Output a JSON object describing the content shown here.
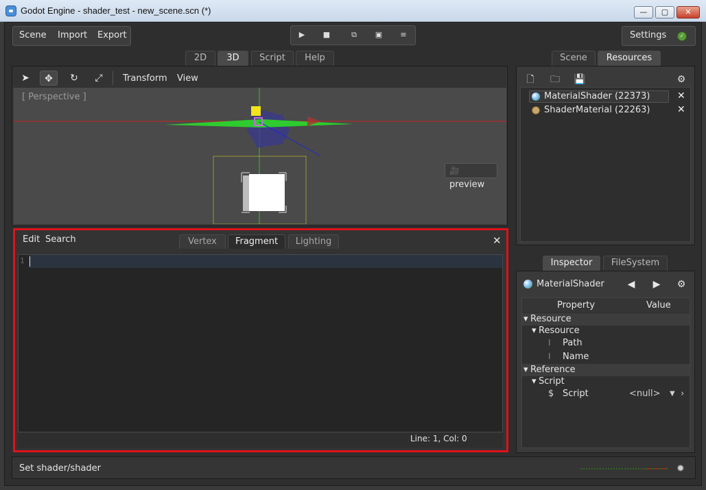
{
  "window": {
    "title": "Godot Engine - shader_test - new_scene.scn (*)",
    "controls": {
      "minimize": "—",
      "maximize": "▢",
      "close": "✕"
    }
  },
  "menu": {
    "scene": "Scene",
    "import": "Import",
    "export": "Export"
  },
  "playback": {
    "play": "▶",
    "stop": "■",
    "play_scene": "⧉",
    "play_custom": "▣",
    "more": "≡"
  },
  "settings": {
    "label": "Settings",
    "ok_icon": "✓"
  },
  "main_tabs": [
    {
      "label": "2D"
    },
    {
      "label": "3D"
    },
    {
      "label": "Script"
    },
    {
      "label": "Help"
    }
  ],
  "viewport": {
    "tools": {
      "select": "➤",
      "move": "✥",
      "rotate": "↻",
      "scale": "⤢"
    },
    "menus": {
      "transform": "Transform",
      "view": "View"
    },
    "perspective_label": "[ Perspective ]",
    "preview_label": "preview",
    "preview_icon": "🎥"
  },
  "shader_editor": {
    "menus": {
      "edit": "Edit",
      "search": "Search"
    },
    "tabs": [
      {
        "label": "Vertex"
      },
      {
        "label": "Fragment"
      },
      {
        "label": "Lighting"
      }
    ],
    "close": "✕",
    "line_number": "1",
    "status": "Line: 1, Col: 0"
  },
  "right_tabs": [
    {
      "label": "Scene"
    },
    {
      "label": "Resources"
    }
  ],
  "resources": {
    "tools": {
      "new": "🗋",
      "open": "🗀",
      "save": "💾",
      "settings": "⚙"
    },
    "items": [
      {
        "label": "MaterialShader (22373)",
        "remove": "✕"
      },
      {
        "label": "ShaderMaterial (22263)",
        "remove": "✕"
      }
    ]
  },
  "bottom_tabs": [
    {
      "label": "Inspector"
    },
    {
      "label": "FileSystem"
    }
  ],
  "inspector": {
    "title": "MaterialShader",
    "nav": {
      "back": "◀",
      "forward": "▶",
      "settings": "⚙"
    },
    "headers": {
      "property": "Property",
      "value": "Value"
    },
    "rows": [
      {
        "label": "Resource"
      },
      {
        "label": "Resource"
      },
      {
        "label": "Path"
      },
      {
        "label": "Name"
      },
      {
        "label": "Reference"
      },
      {
        "label": "Script"
      },
      {
        "label": "Script",
        "value": "<null>"
      }
    ],
    "script_dropdown_icon": "▼",
    "script_arrow_icon": "›"
  },
  "status_bar": {
    "message": "Set shader/shader",
    "spinner": "✹"
  },
  "colors": {
    "highlight_border": "#e0111a",
    "accent_yellow": "#f2e31a",
    "axis_red": "#cc2222",
    "axis_green": "#22cc22",
    "axis_blue": "#2222cc"
  }
}
